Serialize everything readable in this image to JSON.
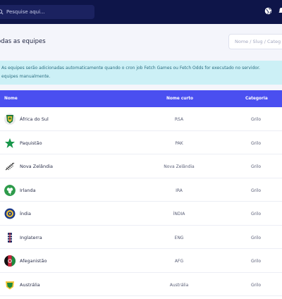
{
  "topbar": {
    "search_placeholder": "Pesquise aqui..."
  },
  "header": {
    "title": "odas as equipes",
    "filter_placeholder": "Nome / Slug / Categ"
  },
  "alert": {
    "line1": "As equipes serão adicionadas automaticamente quando o cron job Fetch Games ou Fetch Odds for executado no servidor.",
    "line2": "equipes manualmente."
  },
  "table": {
    "columns": {
      "name": "Nome",
      "short": "Nome curto",
      "category": "Categoria"
    },
    "rows": [
      {
        "name": "África do Sul",
        "short": "RSA",
        "category": "Grilo",
        "flag": "south-africa-flag-icon"
      },
      {
        "name": "Paquistão",
        "short": "PAK",
        "category": "Grilo",
        "flag": "pakistan-flag-icon"
      },
      {
        "name": "Nova Zelândia",
        "short": "Nova Zelândia",
        "category": "Grilo",
        "flag": "new-zealand-fern-icon"
      },
      {
        "name": "Irlanda",
        "short": "IRA",
        "category": "Grilo",
        "flag": "ireland-flag-icon"
      },
      {
        "name": "Índia",
        "short": "ÍNDIA",
        "category": "Grilo",
        "flag": "india-flag-icon"
      },
      {
        "name": "Inglaterra",
        "short": "ENG",
        "category": "Grilo",
        "flag": "england-flag-icon"
      },
      {
        "name": "Afeganistão",
        "short": "AFG",
        "category": "Grilo",
        "flag": "afghanistan-flag-icon"
      },
      {
        "name": "Austrália",
        "short": "Austrália",
        "category": "Grilo",
        "flag": "australia-flag-icon"
      }
    ]
  },
  "colors": {
    "topbar": "#0e1549",
    "table_header": "#4a4ff0",
    "alert_bg": "#ccf0f6",
    "alert_text": "#2b6f82"
  }
}
